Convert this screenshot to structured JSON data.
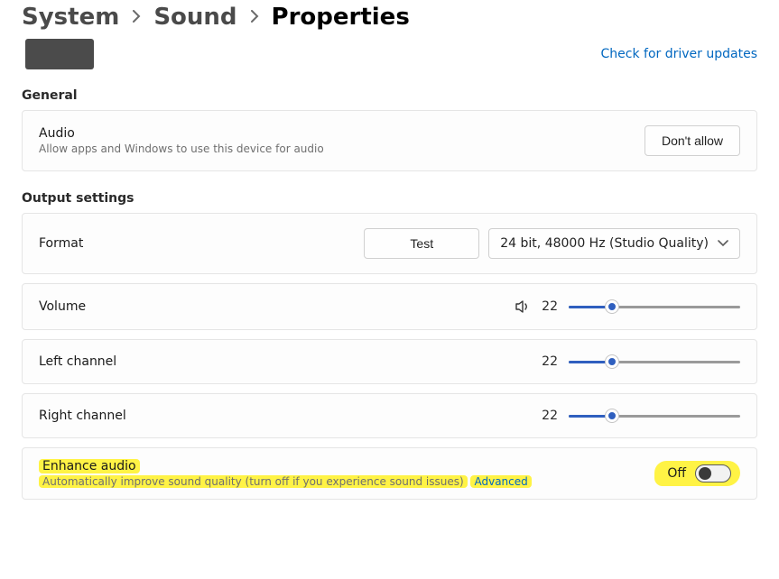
{
  "breadcrumb": {
    "system": "System",
    "sound": "Sound",
    "properties": "Properties"
  },
  "driver_link": "Check for driver updates",
  "sections": {
    "general": "General",
    "output": "Output settings"
  },
  "audio": {
    "title": "Audio",
    "subtitle": "Allow apps and Windows to use this device for audio",
    "button": "Don't allow"
  },
  "format": {
    "label": "Format",
    "test_button": "Test",
    "selected": "24 bit, 48000 Hz (Studio Quality)"
  },
  "volume": {
    "label": "Volume",
    "value": "22",
    "percent": 25
  },
  "left": {
    "label": "Left channel",
    "value": "22",
    "percent": 25
  },
  "right": {
    "label": "Right channel",
    "value": "22",
    "percent": 25
  },
  "enhance": {
    "label": "Enhance audio",
    "subtitle": "Automatically improve sound quality (turn off if you experience sound issues)",
    "advanced": "Advanced",
    "state": "Off"
  }
}
